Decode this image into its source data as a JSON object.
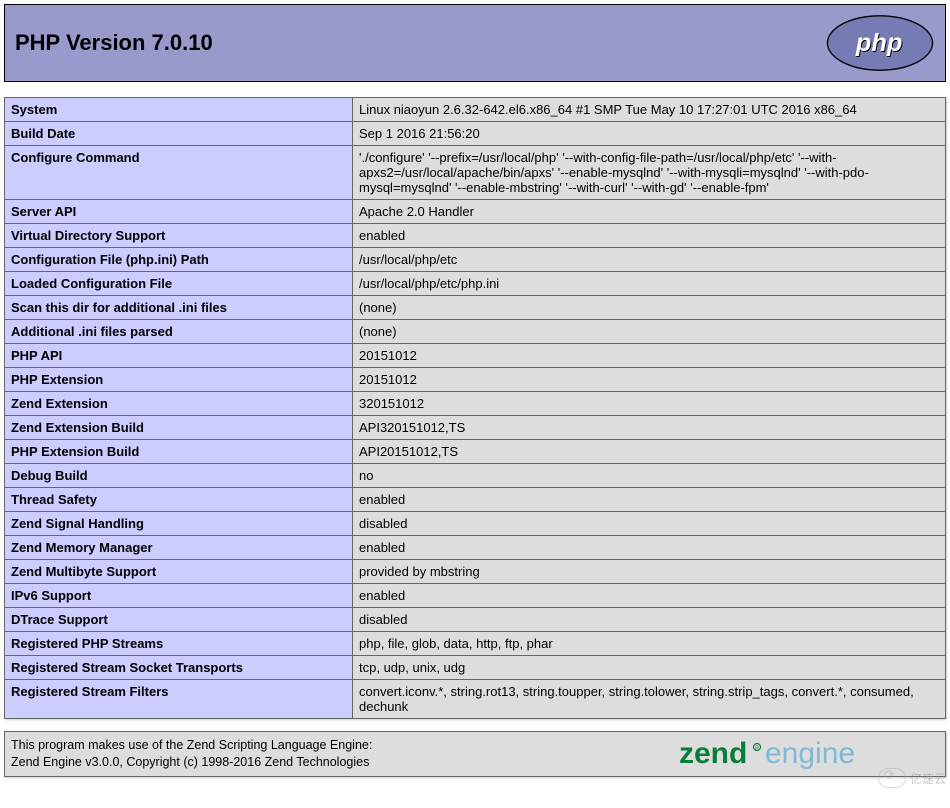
{
  "header": {
    "title": "PHP Version 7.0.10"
  },
  "rows": [
    {
      "key": "System",
      "val": "Linux niaoyun 2.6.32-642.el6.x86_64 #1 SMP Tue May 10 17:27:01 UTC 2016 x86_64"
    },
    {
      "key": "Build Date",
      "val": "Sep 1 2016 21:56:20"
    },
    {
      "key": "Configure Command",
      "val": "'./configure' '--prefix=/usr/local/php' '--with-config-file-path=/usr/local/php/etc' '--with-apxs2=/usr/local/apache/bin/apxs' '--enable-mysqlnd' '--with-mysqli=mysqlnd' '--with-pdo-mysql=mysqlnd' '--enable-mbstring' '--with-curl' '--with-gd' '--enable-fpm'"
    },
    {
      "key": "Server API",
      "val": "Apache 2.0 Handler"
    },
    {
      "key": "Virtual Directory Support",
      "val": "enabled"
    },
    {
      "key": "Configuration File (php.ini) Path",
      "val": "/usr/local/php/etc"
    },
    {
      "key": "Loaded Configuration File",
      "val": "/usr/local/php/etc/php.ini"
    },
    {
      "key": "Scan this dir for additional .ini files",
      "val": "(none)"
    },
    {
      "key": "Additional .ini files parsed",
      "val": "(none)"
    },
    {
      "key": "PHP API",
      "val": "20151012"
    },
    {
      "key": "PHP Extension",
      "val": "20151012"
    },
    {
      "key": "Zend Extension",
      "val": "320151012"
    },
    {
      "key": "Zend Extension Build",
      "val": "API320151012,TS"
    },
    {
      "key": "PHP Extension Build",
      "val": "API20151012,TS"
    },
    {
      "key": "Debug Build",
      "val": "no"
    },
    {
      "key": "Thread Safety",
      "val": "enabled"
    },
    {
      "key": "Zend Signal Handling",
      "val": "disabled"
    },
    {
      "key": "Zend Memory Manager",
      "val": "enabled"
    },
    {
      "key": "Zend Multibyte Support",
      "val": "provided by mbstring"
    },
    {
      "key": "IPv6 Support",
      "val": "enabled"
    },
    {
      "key": "DTrace Support",
      "val": "disabled"
    },
    {
      "key": "Registered PHP Streams",
      "val": "php, file, glob, data, http, ftp, phar"
    },
    {
      "key": "Registered Stream Socket Transports",
      "val": "tcp, udp, unix, udg"
    },
    {
      "key": "Registered Stream Filters",
      "val": "convert.iconv.*, string.rot13, string.toupper, string.tolower, string.strip_tags, convert.*, consumed, dechunk"
    }
  ],
  "footer": {
    "line1": "This program makes use of the Zend Scripting Language Engine:",
    "line2": "Zend Engine v3.0.0, Copyright (c) 1998-2016 Zend Technologies"
  },
  "watermark": "亿速云"
}
